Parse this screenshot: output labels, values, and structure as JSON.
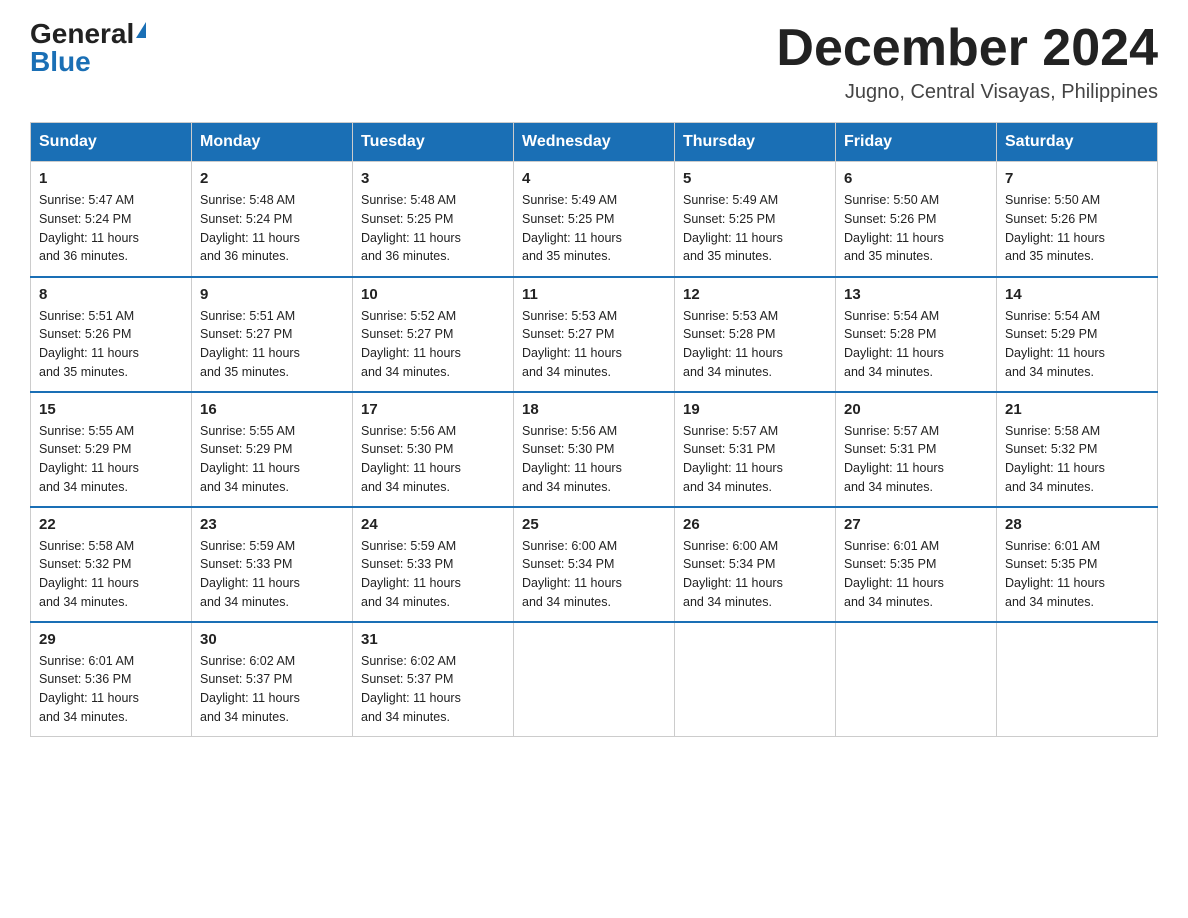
{
  "logo": {
    "general": "General",
    "blue": "Blue"
  },
  "title": "December 2024",
  "location": "Jugno, Central Visayas, Philippines",
  "days_of_week": [
    "Sunday",
    "Monday",
    "Tuesday",
    "Wednesday",
    "Thursday",
    "Friday",
    "Saturday"
  ],
  "weeks": [
    [
      {
        "day": "1",
        "sunrise": "5:47 AM",
        "sunset": "5:24 PM",
        "daylight": "11 hours and 36 minutes."
      },
      {
        "day": "2",
        "sunrise": "5:48 AM",
        "sunset": "5:24 PM",
        "daylight": "11 hours and 36 minutes."
      },
      {
        "day": "3",
        "sunrise": "5:48 AM",
        "sunset": "5:25 PM",
        "daylight": "11 hours and 36 minutes."
      },
      {
        "day": "4",
        "sunrise": "5:49 AM",
        "sunset": "5:25 PM",
        "daylight": "11 hours and 35 minutes."
      },
      {
        "day": "5",
        "sunrise": "5:49 AM",
        "sunset": "5:25 PM",
        "daylight": "11 hours and 35 minutes."
      },
      {
        "day": "6",
        "sunrise": "5:50 AM",
        "sunset": "5:26 PM",
        "daylight": "11 hours and 35 minutes."
      },
      {
        "day": "7",
        "sunrise": "5:50 AM",
        "sunset": "5:26 PM",
        "daylight": "11 hours and 35 minutes."
      }
    ],
    [
      {
        "day": "8",
        "sunrise": "5:51 AM",
        "sunset": "5:26 PM",
        "daylight": "11 hours and 35 minutes."
      },
      {
        "day": "9",
        "sunrise": "5:51 AM",
        "sunset": "5:27 PM",
        "daylight": "11 hours and 35 minutes."
      },
      {
        "day": "10",
        "sunrise": "5:52 AM",
        "sunset": "5:27 PM",
        "daylight": "11 hours and 34 minutes."
      },
      {
        "day": "11",
        "sunrise": "5:53 AM",
        "sunset": "5:27 PM",
        "daylight": "11 hours and 34 minutes."
      },
      {
        "day": "12",
        "sunrise": "5:53 AM",
        "sunset": "5:28 PM",
        "daylight": "11 hours and 34 minutes."
      },
      {
        "day": "13",
        "sunrise": "5:54 AM",
        "sunset": "5:28 PM",
        "daylight": "11 hours and 34 minutes."
      },
      {
        "day": "14",
        "sunrise": "5:54 AM",
        "sunset": "5:29 PM",
        "daylight": "11 hours and 34 minutes."
      }
    ],
    [
      {
        "day": "15",
        "sunrise": "5:55 AM",
        "sunset": "5:29 PM",
        "daylight": "11 hours and 34 minutes."
      },
      {
        "day": "16",
        "sunrise": "5:55 AM",
        "sunset": "5:29 PM",
        "daylight": "11 hours and 34 minutes."
      },
      {
        "day": "17",
        "sunrise": "5:56 AM",
        "sunset": "5:30 PM",
        "daylight": "11 hours and 34 minutes."
      },
      {
        "day": "18",
        "sunrise": "5:56 AM",
        "sunset": "5:30 PM",
        "daylight": "11 hours and 34 minutes."
      },
      {
        "day": "19",
        "sunrise": "5:57 AM",
        "sunset": "5:31 PM",
        "daylight": "11 hours and 34 minutes."
      },
      {
        "day": "20",
        "sunrise": "5:57 AM",
        "sunset": "5:31 PM",
        "daylight": "11 hours and 34 minutes."
      },
      {
        "day": "21",
        "sunrise": "5:58 AM",
        "sunset": "5:32 PM",
        "daylight": "11 hours and 34 minutes."
      }
    ],
    [
      {
        "day": "22",
        "sunrise": "5:58 AM",
        "sunset": "5:32 PM",
        "daylight": "11 hours and 34 minutes."
      },
      {
        "day": "23",
        "sunrise": "5:59 AM",
        "sunset": "5:33 PM",
        "daylight": "11 hours and 34 minutes."
      },
      {
        "day": "24",
        "sunrise": "5:59 AM",
        "sunset": "5:33 PM",
        "daylight": "11 hours and 34 minutes."
      },
      {
        "day": "25",
        "sunrise": "6:00 AM",
        "sunset": "5:34 PM",
        "daylight": "11 hours and 34 minutes."
      },
      {
        "day": "26",
        "sunrise": "6:00 AM",
        "sunset": "5:34 PM",
        "daylight": "11 hours and 34 minutes."
      },
      {
        "day": "27",
        "sunrise": "6:01 AM",
        "sunset": "5:35 PM",
        "daylight": "11 hours and 34 minutes."
      },
      {
        "day": "28",
        "sunrise": "6:01 AM",
        "sunset": "5:35 PM",
        "daylight": "11 hours and 34 minutes."
      }
    ],
    [
      {
        "day": "29",
        "sunrise": "6:01 AM",
        "sunset": "5:36 PM",
        "daylight": "11 hours and 34 minutes."
      },
      {
        "day": "30",
        "sunrise": "6:02 AM",
        "sunset": "5:37 PM",
        "daylight": "11 hours and 34 minutes."
      },
      {
        "day": "31",
        "sunrise": "6:02 AM",
        "sunset": "5:37 PM",
        "daylight": "11 hours and 34 minutes."
      },
      null,
      null,
      null,
      null
    ]
  ]
}
